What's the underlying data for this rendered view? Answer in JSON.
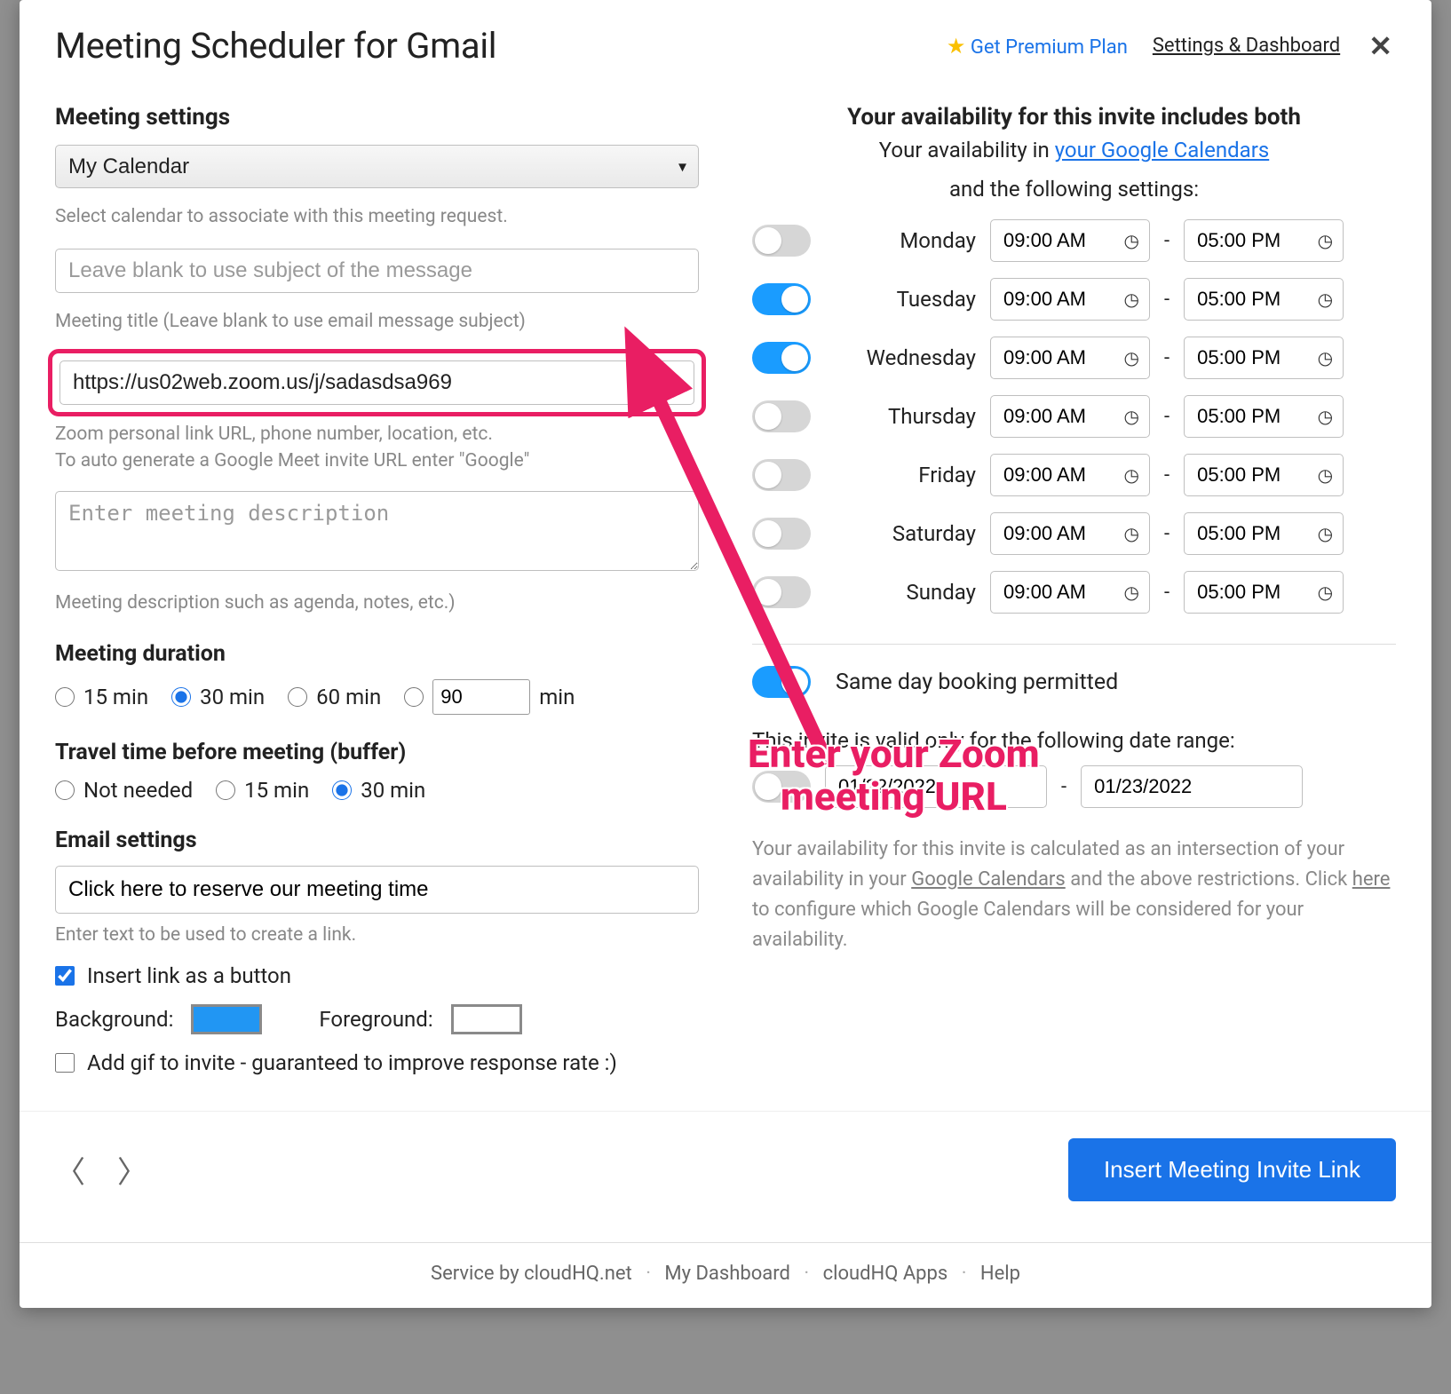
{
  "header": {
    "title": "Meeting Scheduler for Gmail",
    "premium": "Get Premium Plan",
    "settings": "Settings & Dashboard"
  },
  "left": {
    "meeting_settings_title": "Meeting settings",
    "calendar_value": "My Calendar",
    "calendar_helper": "Select calendar to associate with this meeting request.",
    "title_placeholder": "Leave blank to use subject of the message",
    "title_helper": "Meeting title (Leave blank to use email message subject)",
    "location_value": "https://us02web.zoom.us/j/sadasdsa969",
    "location_helper_1": "Zoom personal link URL, phone number, location, etc.",
    "location_helper_2": "To auto generate a Google Meet invite URL enter \"Google\"",
    "desc_placeholder": "Enter meeting description",
    "desc_helper": "Meeting description such as agenda, notes, etc.)",
    "duration_title": "Meeting duration",
    "duration": {
      "opt15": "15 min",
      "opt30": "30 min",
      "opt60": "60 min",
      "custom_value": "90",
      "min_label": "min"
    },
    "buffer_title": "Travel time before meeting (buffer)",
    "buffer": {
      "none": "Not needed",
      "opt15": "15 min",
      "opt30": "30 min"
    },
    "email_settings_title": "Email settings",
    "email_link_text": "Click here to reserve our meeting time",
    "email_helper": "Enter text to be used to create a link.",
    "insert_as_button_label": "Insert link as a button",
    "background_label": "Background:",
    "foreground_label": "Foreground:",
    "add_gif_label": "Add gif to invite - guaranteed to improve response rate :)"
  },
  "right": {
    "avail_head": "Your availability for this invite includes both",
    "avail_sub_prefix": "Your availability in ",
    "avail_sub_link": "your Google Calendars",
    "avail_sub_following": "and the following settings:",
    "days": [
      {
        "name": "Monday",
        "on": false,
        "start": "09:00 AM",
        "end": "05:00 PM"
      },
      {
        "name": "Tuesday",
        "on": true,
        "start": "09:00 AM",
        "end": "05:00 PM"
      },
      {
        "name": "Wednesday",
        "on": true,
        "start": "09:00 AM",
        "end": "05:00 PM"
      },
      {
        "name": "Thursday",
        "on": false,
        "start": "09:00 AM",
        "end": "05:00 PM"
      },
      {
        "name": "Friday",
        "on": false,
        "start": "09:00 AM",
        "end": "05:00 PM"
      },
      {
        "name": "Saturday",
        "on": false,
        "start": "09:00 AM",
        "end": "05:00 PM"
      },
      {
        "name": "Sunday",
        "on": false,
        "start": "09:00 AM",
        "end": "05:00 PM"
      }
    ],
    "same_day_label": "Same day booking permitted",
    "date_range_text": "This invite is valid only for the following date range:",
    "date_start": "01/22/2022",
    "date_end": "01/23/2022",
    "calc_text_1": "Your availability for this invite is calculated as an intersection of your availability in your ",
    "calc_link_1": "Google Calendars",
    "calc_text_2": " and the above restrictions. Click ",
    "calc_link_2": "here",
    "calc_text_3": " to configure which Google Calendars will be considered for your availability."
  },
  "footer": {
    "insert_button": "Insert Meeting Invite Link",
    "service_by": "Service by ",
    "service_link": "cloudHQ.net",
    "dashboard": "My Dashboard",
    "apps": "cloudHQ Apps",
    "help": "Help"
  },
  "annotation": {
    "text_1": "Enter your Zoom",
    "text_2": "meeting URL"
  }
}
